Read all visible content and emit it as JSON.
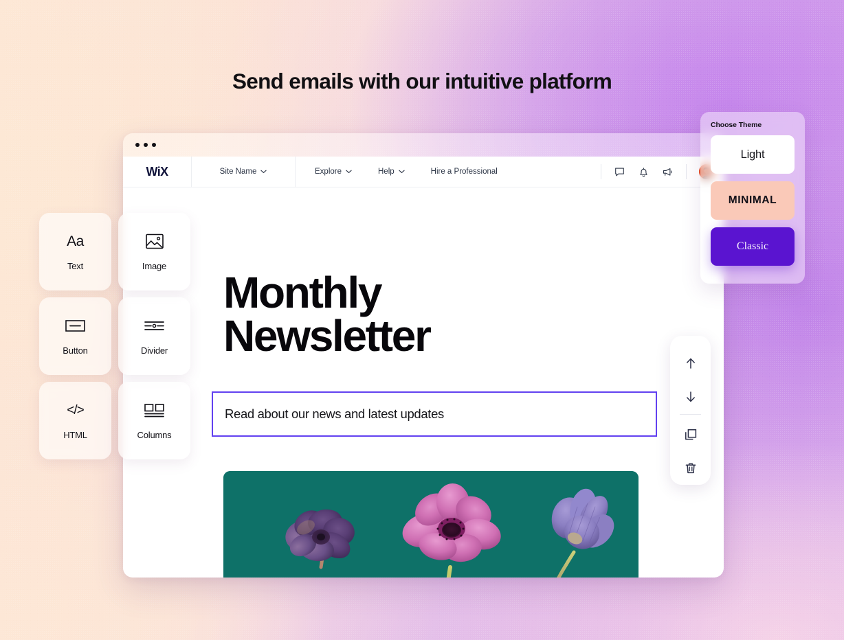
{
  "hero": {
    "title": "Send emails with our intuitive platform"
  },
  "editor_window": {
    "titlebar": {
      "dots_icon": "window-dots-icon"
    },
    "nav": {
      "logo_text": "WiX",
      "site_name": "Site Name",
      "links": [
        {
          "label": "Explore",
          "has_caret": true
        },
        {
          "label": "Help",
          "has_caret": true
        },
        {
          "label": "Hire a Professional",
          "has_caret": false
        }
      ],
      "icons": [
        "chat-bubble-icon",
        "bell-icon",
        "megaphone-icon"
      ],
      "avatar": "user-avatar"
    },
    "canvas": {
      "newsletter_title": "Monthly Newsletter",
      "subtitle": "Read about our news and latest updates",
      "subtitle_selected": true,
      "selection_color": "#6241f0",
      "image": {
        "name": "anemone-flowers-photo",
        "background_color": "#0e7168",
        "alt": "Three purple and pink anemone flowers on teal background"
      }
    }
  },
  "palette": {
    "items": [
      {
        "label": "Text",
        "icon": "text-aa-icon"
      },
      {
        "label": "Image",
        "icon": "image-icon"
      },
      {
        "label": "Button",
        "icon": "button-icon"
      },
      {
        "label": "Divider",
        "icon": "divider-icon"
      },
      {
        "label": "HTML",
        "icon": "html-code-icon"
      },
      {
        "label": "Columns",
        "icon": "columns-icon"
      }
    ]
  },
  "float_toolbar": {
    "buttons": [
      {
        "name": "move-up-button",
        "icon": "arrow-up-icon"
      },
      {
        "name": "move-down-button",
        "icon": "arrow-down-icon"
      },
      {
        "name": "duplicate-button",
        "icon": "duplicate-icon"
      },
      {
        "name": "delete-button",
        "icon": "trash-icon"
      }
    ]
  },
  "theme_panel": {
    "title": "Choose Theme",
    "themes": [
      {
        "label": "Light",
        "color": "#ffffff"
      },
      {
        "label": "MINIMAL",
        "color": "#fac9b8"
      },
      {
        "label": "Classic",
        "color": "#5a14d0"
      }
    ]
  }
}
